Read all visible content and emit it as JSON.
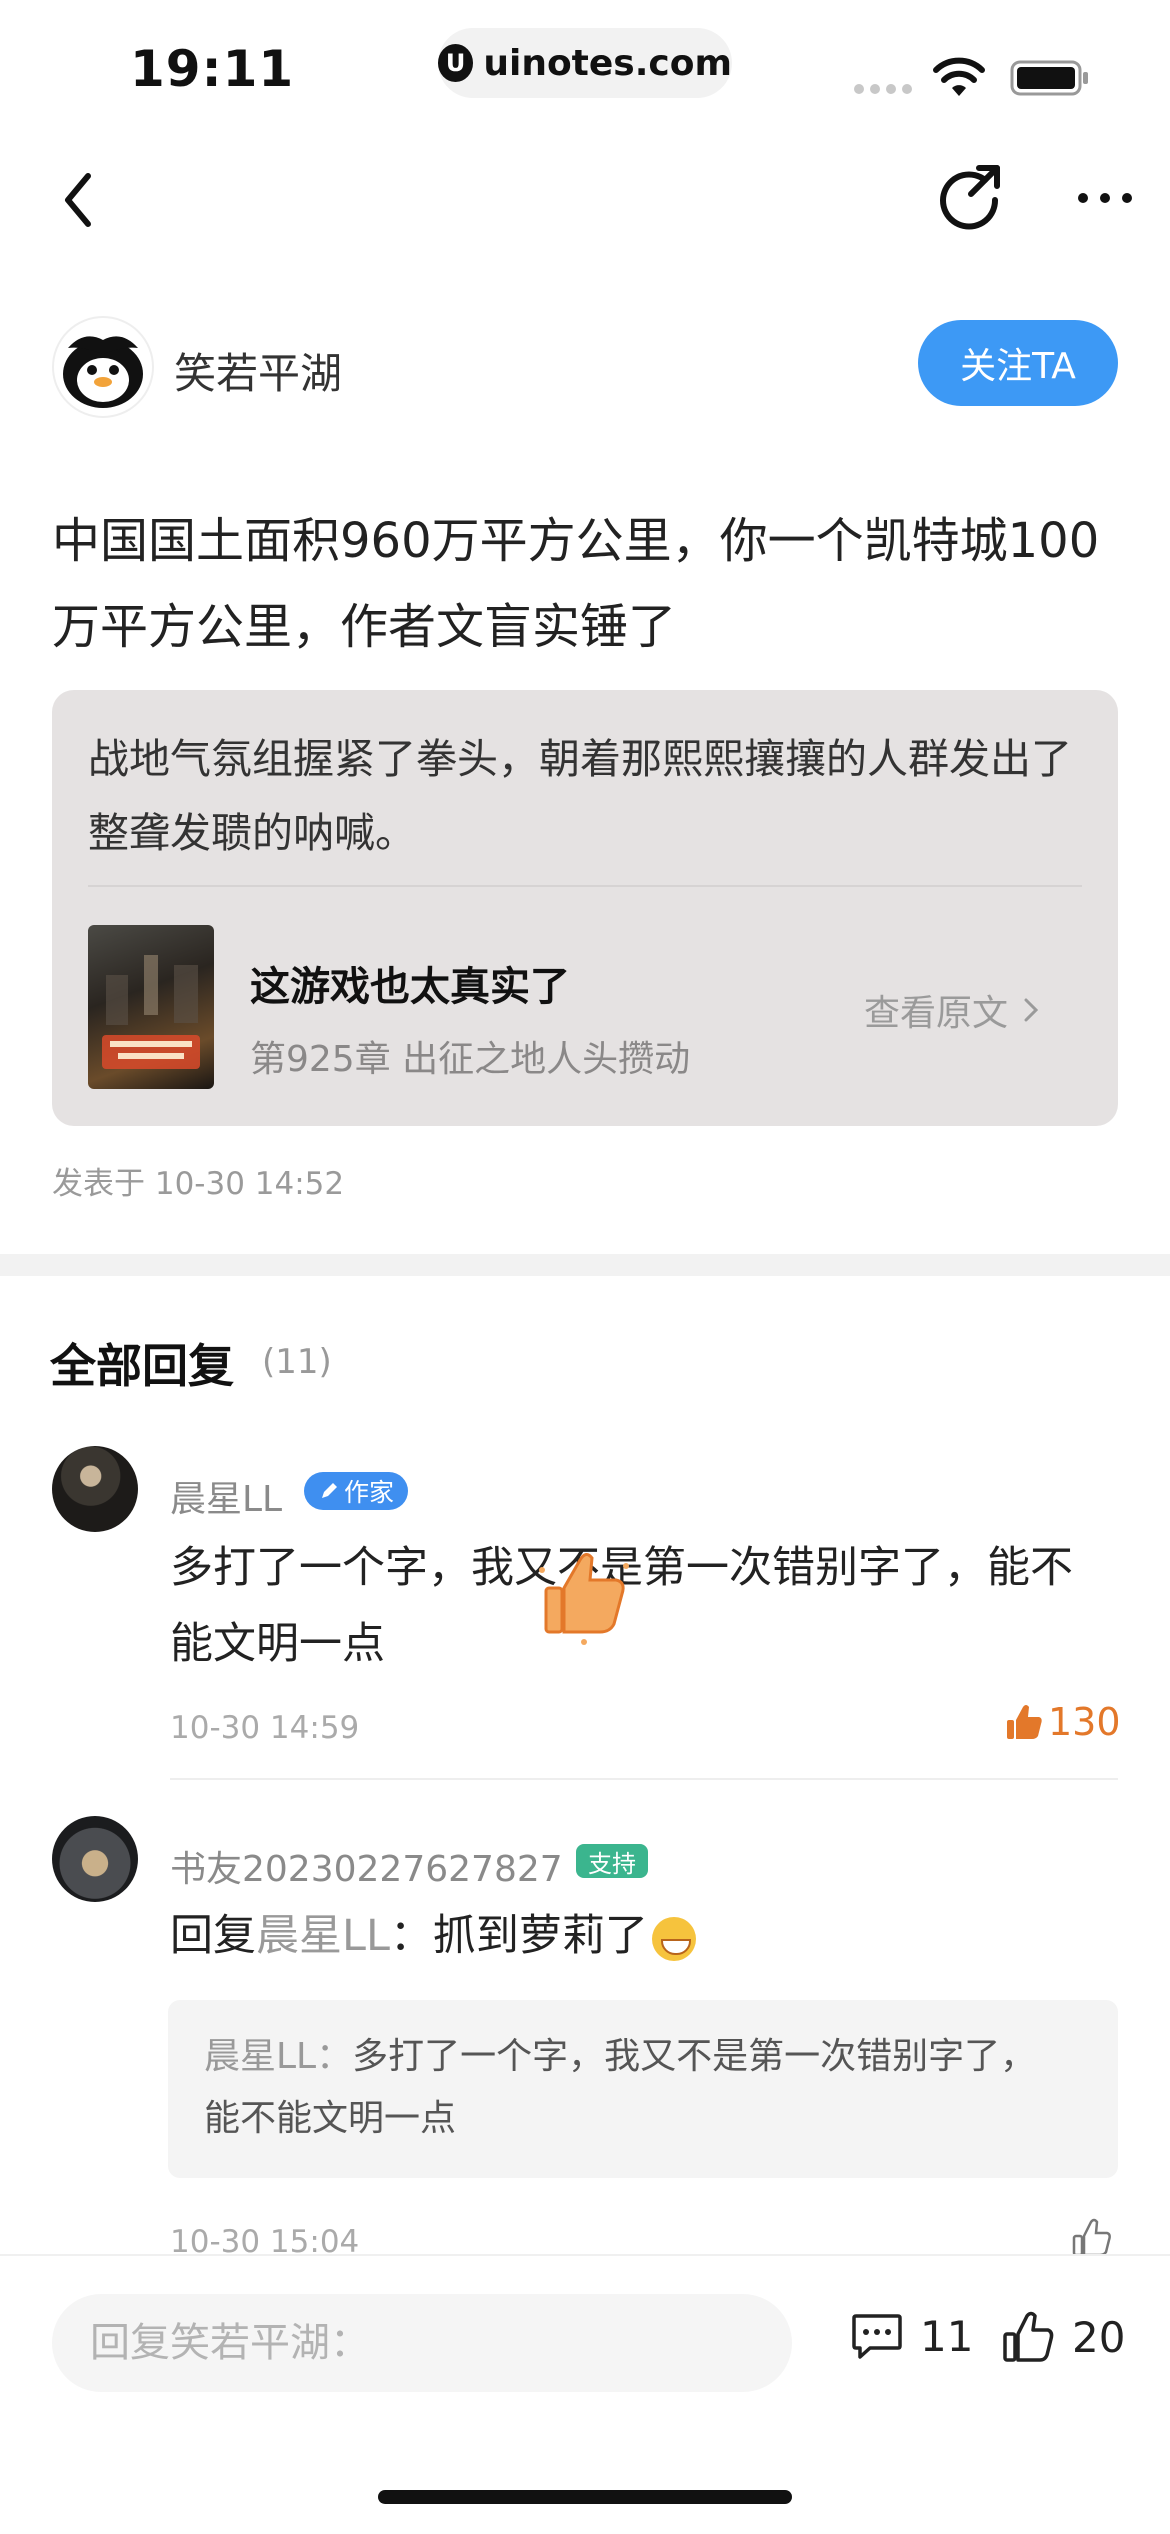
{
  "status_bar": {
    "time": "19:11",
    "url": "uinotes.com"
  },
  "author": {
    "name": "笑若平湖",
    "follow_label": "关注TA"
  },
  "post": {
    "text": "中国国土面积960万平方公里，你一个凯特城100万平方公里，作者文盲实锤了",
    "time": "发表于 10-30 14:52"
  },
  "quote": {
    "text": "战地气氛组握紧了拳头，朝着那熙熙攘攘的人群发出了整聋发聩的呐喊。",
    "book_title": "这游戏也太真实了",
    "chapter": "第925章 出征之地人头攒动",
    "view_label": "查看原文"
  },
  "replies": {
    "title": "全部回复",
    "count": "(11)",
    "items": [
      {
        "name": "晨星LL",
        "badge": "作家",
        "text": "多打了一个字，我又不是第一次错别字了，能不能文明一点",
        "time": "10-30 14:59",
        "likes": "130"
      },
      {
        "name": "书友20230227627827",
        "badge": "支持",
        "reply_prefix": "回复",
        "mention": "晨星LL",
        "colon": "：",
        "text": "抓到萝莉了",
        "quote_name": "晨星LL：",
        "quote_text": "多打了一个字，我又不是第一次错别字了，能不能文明一点",
        "time": "10-30 15:04"
      }
    ]
  },
  "bottom_bar": {
    "reply_placeholder": "回复笑若平湖：",
    "comment_count": "11",
    "like_count": "20"
  },
  "colors": {
    "accent": "#3d99f5",
    "like_orange": "#e3782a",
    "support_green": "#3bb58e"
  }
}
